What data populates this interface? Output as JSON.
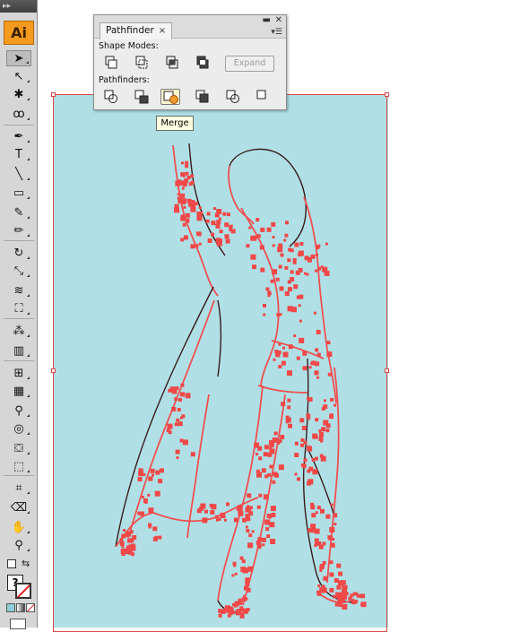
{
  "app": {
    "logo_text": "Ai",
    "grip_text": "▸▸"
  },
  "tools": [
    {
      "name": "selection-tool",
      "icon": "arrow-icon",
      "glyph": "➤",
      "active": true
    },
    {
      "name": "direct-selection-tool",
      "icon": "hollow-arrow-icon",
      "glyph": "↖",
      "active": false
    },
    {
      "name": "magic-wand-tool",
      "icon": "wand-icon",
      "glyph": "✱",
      "active": false
    },
    {
      "name": "lasso-tool",
      "icon": "lasso-icon",
      "glyph": "ꝏ",
      "active": false
    },
    {
      "name": "pen-tool",
      "icon": "pen-icon",
      "glyph": "✒",
      "active": false
    },
    {
      "name": "type-tool",
      "icon": "type-icon",
      "glyph": "T",
      "active": false
    },
    {
      "name": "line-tool",
      "icon": "line-icon",
      "glyph": "╲",
      "active": false
    },
    {
      "name": "rectangle-tool",
      "icon": "rectangle-icon",
      "glyph": "▭",
      "active": false
    },
    {
      "name": "paintbrush-tool",
      "icon": "brush-icon",
      "glyph": "✎",
      "active": false
    },
    {
      "name": "pencil-tool",
      "icon": "pencil-icon",
      "glyph": "✏",
      "active": false
    },
    {
      "name": "rotate-tool",
      "icon": "rotate-icon",
      "glyph": "↻",
      "active": false
    },
    {
      "name": "scale-tool",
      "icon": "scale-icon",
      "glyph": "⤡",
      "active": false
    },
    {
      "name": "warp-tool",
      "icon": "warp-icon",
      "glyph": "≋",
      "active": false
    },
    {
      "name": "free-transform-tool",
      "icon": "free-transform-icon",
      "glyph": "⛶",
      "active": false
    },
    {
      "name": "symbol-sprayer-tool",
      "icon": "sprayer-icon",
      "glyph": "⁂",
      "active": false
    },
    {
      "name": "column-graph-tool",
      "icon": "graph-icon",
      "glyph": "▥",
      "active": false
    },
    {
      "name": "mesh-tool",
      "icon": "mesh-icon",
      "glyph": "⊞",
      "active": false
    },
    {
      "name": "gradient-tool",
      "icon": "gradient-icon",
      "glyph": "▦",
      "active": false
    },
    {
      "name": "eyedropper-tool",
      "icon": "eyedropper-icon",
      "glyph": "⚲",
      "active": false
    },
    {
      "name": "blend-tool",
      "icon": "blend-icon",
      "glyph": "◎",
      "active": false
    },
    {
      "name": "live-paint-bucket-tool",
      "icon": "paint-bucket-icon",
      "glyph": "⛋",
      "active": false
    },
    {
      "name": "live-paint-selection-tool",
      "icon": "live-paint-select-icon",
      "glyph": "⬚",
      "active": false
    },
    {
      "name": "slice-tool",
      "icon": "crop-icon",
      "glyph": "⌗",
      "active": false
    },
    {
      "name": "eraser-tool",
      "icon": "eraser-icon",
      "glyph": "⌫",
      "active": false
    },
    {
      "name": "hand-tool",
      "icon": "hand-icon",
      "glyph": "✋",
      "active": false
    },
    {
      "name": "zoom-tool",
      "icon": "zoom-icon",
      "glyph": "⚲",
      "active": false
    }
  ],
  "pathfinder": {
    "tab_label": "Pathfinder",
    "close_glyph": "×",
    "shape_modes_label": "Shape Modes:",
    "pathfinders_label": "Pathfinders:",
    "expand_label": "Expand",
    "tooltip": "Merge",
    "shape_modes": [
      "unite",
      "minus-front",
      "intersect",
      "exclude"
    ],
    "pathfinder_ops": [
      "divide",
      "trim",
      "merge",
      "crop",
      "outline",
      "minus-back"
    ]
  },
  "colors": {
    "artboard": "#b0e0e6",
    "path": "#f05050",
    "anchor": "#f04848",
    "selection": "#e04646"
  }
}
